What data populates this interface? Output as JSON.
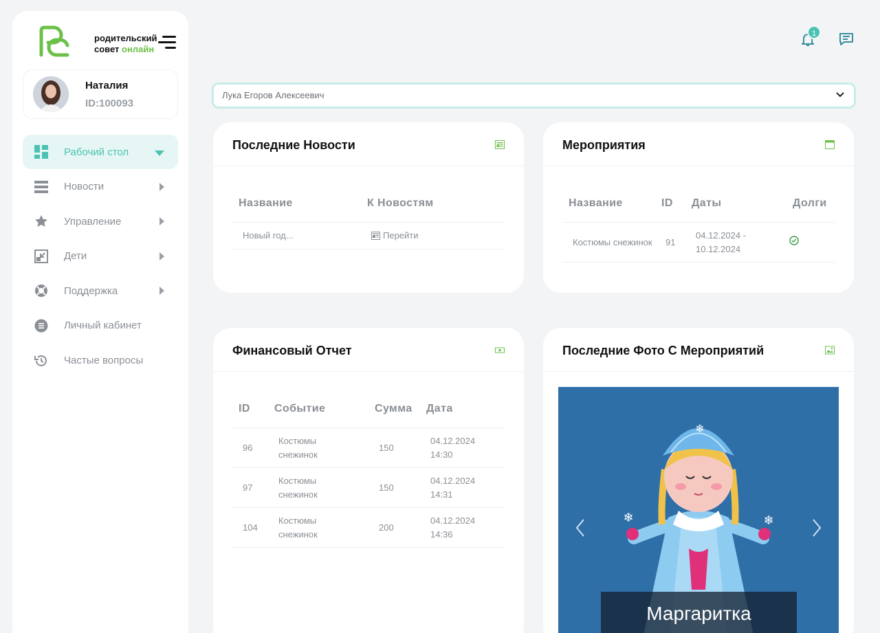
{
  "brand": {
    "line1": "родительский",
    "line2": "совет",
    "line2_accent": "онлайн"
  },
  "profile": {
    "name": "Наталия",
    "id": "ID:100093"
  },
  "nav": [
    {
      "label": "Рабочий стол",
      "icon": "dashboard-icon",
      "active": true
    },
    {
      "label": "Новости",
      "icon": "list-icon"
    },
    {
      "label": "Управление",
      "icon": "star-icon"
    },
    {
      "label": "Дети",
      "icon": "shrink-icon"
    },
    {
      "label": "Поддержка",
      "icon": "lifebuoy-icon"
    },
    {
      "label": "Личный кабинет",
      "icon": "document-icon"
    },
    {
      "label": "Частые вопросы",
      "icon": "history-icon"
    }
  ],
  "notifications": {
    "count": "1"
  },
  "child_select": {
    "value": "Лука Егоров Алексеевич"
  },
  "news": {
    "title": "Последние Новости",
    "headers": [
      "Название",
      "К Новостям"
    ],
    "rows": [
      {
        "name": "Новый год...",
        "link": "Перейти"
      }
    ]
  },
  "events": {
    "title": "Мероприятия",
    "headers": [
      "Название",
      "ID",
      "Даты",
      "Долги"
    ],
    "rows": [
      {
        "name": "Костюмы снежинок",
        "id": "91",
        "dates": "04.12.2024 - 10.12.2024",
        "debt_paid": true
      }
    ]
  },
  "finance": {
    "title": "Финансовый Отчет",
    "headers": [
      "ID",
      "Событие",
      "Сумма",
      "Дата"
    ],
    "rows": [
      {
        "id": "96",
        "event": "Костюмы снежинок",
        "sum": "150",
        "date": "04.12.2024 14:30"
      },
      {
        "id": "97",
        "event": "Костюмы снежинок",
        "sum": "150",
        "date": "04.12.2024 14:31"
      },
      {
        "id": "104",
        "event": "Костюмы снежинок",
        "sum": "200",
        "date": "04.12.2024 14:36"
      }
    ]
  },
  "photos": {
    "title": "Последние Фото С Мероприятий",
    "caption": "Маргаритка"
  },
  "colors": {
    "accent": "#4cc3b2",
    "brand_green": "#6cc04a",
    "photo_bg": "#2e6fa8"
  }
}
